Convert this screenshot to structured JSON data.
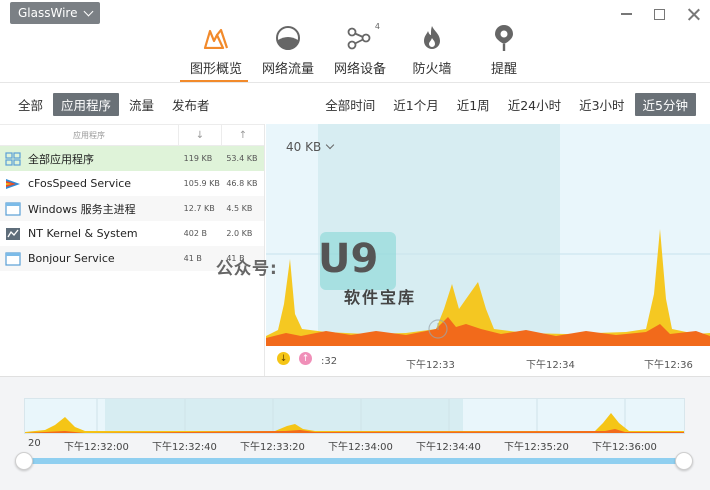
{
  "window": {
    "brand": "GlassWire"
  },
  "nav": [
    {
      "label": "图形概览",
      "icon": "graph-icon",
      "active": true
    },
    {
      "label": "网络流量",
      "icon": "traffic-gauge-icon",
      "active": false
    },
    {
      "label": "网络设备",
      "icon": "network-devices-icon",
      "badge": "4",
      "active": false
    },
    {
      "label": "防火墙",
      "icon": "firewall-flame-icon",
      "active": false
    },
    {
      "label": "提醒",
      "icon": "alert-pin-icon",
      "active": false
    }
  ],
  "filters": {
    "left": [
      "全部",
      "应用程序",
      "流量",
      "发布者"
    ],
    "left_selected": "应用程序",
    "right": [
      "全部时间",
      "近1个月",
      "近1周",
      "近24小时",
      "近3小时",
      "近5分钟"
    ],
    "right_selected": "近5分钟"
  },
  "applist": {
    "header": {
      "name": "应用程序",
      "down": "↓",
      "up": "↑"
    },
    "rows": [
      {
        "name": "全部应用程序",
        "down": "119 KB",
        "up": "53.4 KB",
        "icon": "all-apps-grid-icon"
      },
      {
        "name": "cFosSpeed Service",
        "down": "105.9 KB",
        "up": "46.8 KB",
        "icon": "cfosspeed-icon"
      },
      {
        "name": "Windows 服务主进程",
        "down": "12.7 KB",
        "up": "4.5 KB",
        "icon": "window-app-icon"
      },
      {
        "name": "NT Kernel & System",
        "down": "402 B",
        "up": "2.0 KB",
        "icon": "nt-kernel-icon"
      },
      {
        "name": "Bonjour Service",
        "down": "41 B",
        "up": "41 B",
        "icon": "window-app-icon"
      }
    ]
  },
  "graph": {
    "scale_label": "40 KB",
    "legend": {
      "download_symbol": "↓",
      "upload_symbol": "↑"
    },
    "time_ticks": [
      ":32",
      "下午12:33",
      "下午12:34",
      "下午12:36"
    ]
  },
  "overview": {
    "ticks": [
      "20",
      "下午12:32:00",
      "下午12:32:40",
      "下午12:33:20",
      "下午12:34:00",
      "下午12:34:40",
      "下午12:35:20",
      "下午12:36:00"
    ]
  },
  "watermark": {
    "line1": "公众号:",
    "logo": "U9",
    "line2": "软件宝库"
  },
  "colors": {
    "accent": "#f28a2b",
    "download": "#f5c516",
    "upload": "#f26a1b",
    "selected_filter": "#6a7177",
    "selected_row": "#dff3d9"
  }
}
